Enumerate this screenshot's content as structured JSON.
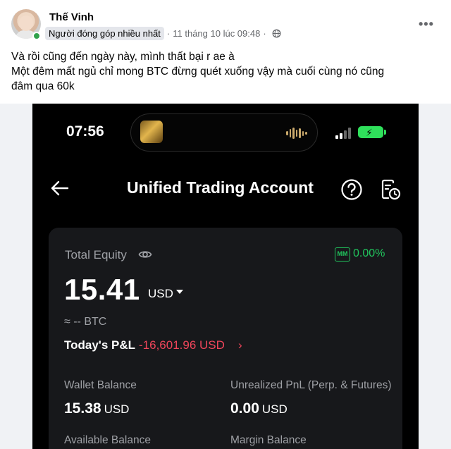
{
  "post": {
    "author": "Thế Vinh",
    "badge": "Người đóng góp nhiều nhất",
    "separator": "·",
    "timestamp": "11 tháng 10 lúc 09:48",
    "privacy_icon": "globe-icon",
    "more": "•••",
    "text_lines": [
      "Và rồi cũng đến ngày này, mình thất bại r ae à",
      "Một đêm mất ngủ chỉ mong BTC đừng quét xuống vậy mà cuối cùng nó cũng",
      "đâm qua 60k"
    ]
  },
  "phone": {
    "status": {
      "time": "07:56",
      "battery_color": "#2fe05b"
    },
    "nav": {
      "title": "Unified Trading Account",
      "back_icon": "back-arrow-icon",
      "help_icon": "help-icon",
      "history_icon": "history-icon"
    },
    "account": {
      "equity_label": "Total Equity",
      "mm_badge": "MM",
      "mm_rate": "0.00%",
      "equity_value": "15.41",
      "equity_unit": "USD",
      "btc_value": "≈ -- BTC",
      "pnl_label": "Today's P&L",
      "pnl_value": "-16,601.96 USD",
      "pnl_chevron": "›",
      "wallet_label": "Wallet Balance",
      "wallet_value": "15.38",
      "wallet_unit": "USD",
      "unrealized_label": "Unrealized PnL (Perp. & Futures)",
      "unrealized_value": "0.00",
      "unrealized_unit": "USD",
      "available_label": "Available Balance",
      "margin_label": "Margin Balance"
    },
    "colors": {
      "positive": "#21c55d",
      "negative": "#f0455a",
      "background": "#000000",
      "card": "#17181b"
    }
  }
}
